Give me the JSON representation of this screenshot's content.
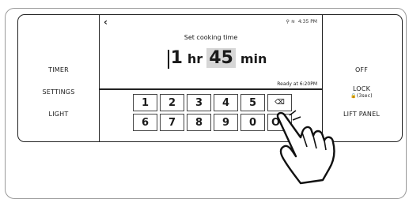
{
  "left_buttons": [
    {
      "label": "TIMER"
    },
    {
      "label": "SETTINGS"
    },
    {
      "label": "LIGHT"
    }
  ],
  "right_buttons": [
    {
      "label": "OFF",
      "sub": ""
    },
    {
      "label": "LOCK",
      "sub": "🔒(3sec)"
    },
    {
      "label": "LIFT PANEL",
      "sub": ""
    }
  ],
  "screen": {
    "back_icon": "‹",
    "status_icons": "⚲ ≋",
    "clock": "4:35 PM",
    "title": "Set cooking time",
    "hours": "1",
    "hours_unit": "hr",
    "minutes": "45",
    "minutes_unit": "min",
    "ready": "Ready at 6:20PM"
  },
  "keypad": {
    "row1": [
      "1",
      "2",
      "3",
      "4",
      "5",
      "⌫"
    ],
    "row2": [
      "6",
      "7",
      "8",
      "9",
      "0",
      "OK"
    ]
  },
  "colors": {
    "border": "#222222",
    "highlight": "#d6d6d6"
  }
}
